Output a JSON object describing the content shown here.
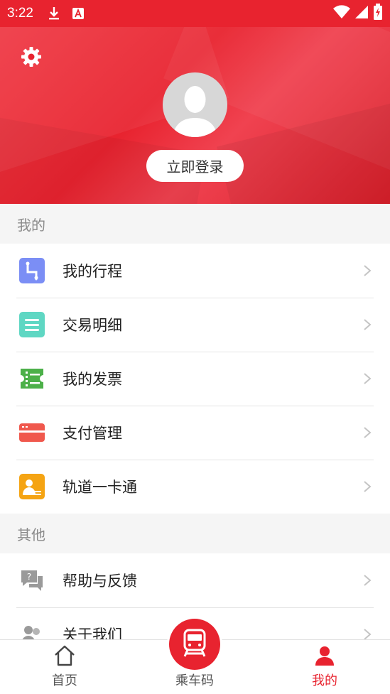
{
  "status_bar": {
    "time": "3:22",
    "icons": [
      "download-icon",
      "font-icon",
      "wifi-icon",
      "signal-icon",
      "battery-charging-icon"
    ]
  },
  "profile": {
    "settings_icon": "gear-icon",
    "avatar_icon": "default-avatar-icon",
    "login_label": "立即登录"
  },
  "section_mine": {
    "title": "我的",
    "items": [
      {
        "label": "我的行程",
        "icon": "route-icon",
        "color": "#7b8ef5"
      },
      {
        "label": "交易明细",
        "icon": "list-icon",
        "color": "#5fd7c3"
      },
      {
        "label": "我的发票",
        "icon": "invoice-icon",
        "color": "#4cb049"
      },
      {
        "label": "支付管理",
        "icon": "card-icon",
        "color": "#f0584d"
      },
      {
        "label": "轨道一卡通",
        "icon": "id-card-icon",
        "color": "#f5a413"
      }
    ]
  },
  "section_other": {
    "title": "其他",
    "items": [
      {
        "label": "帮助与反馈",
        "icon": "help-feedback-icon",
        "color": "#9a9a9a"
      },
      {
        "label": "关于我们",
        "icon": "about-users-icon",
        "color": "#9a9a9a"
      }
    ]
  },
  "tabbar": {
    "tabs": [
      {
        "label": "首页",
        "icon": "home-icon"
      },
      {
        "label": "乘车码",
        "icon": "train-icon"
      },
      {
        "label": "我的",
        "icon": "person-icon",
        "active": true
      }
    ]
  },
  "colors": {
    "primary": "#e8232f",
    "background": "#f5f5f5"
  }
}
